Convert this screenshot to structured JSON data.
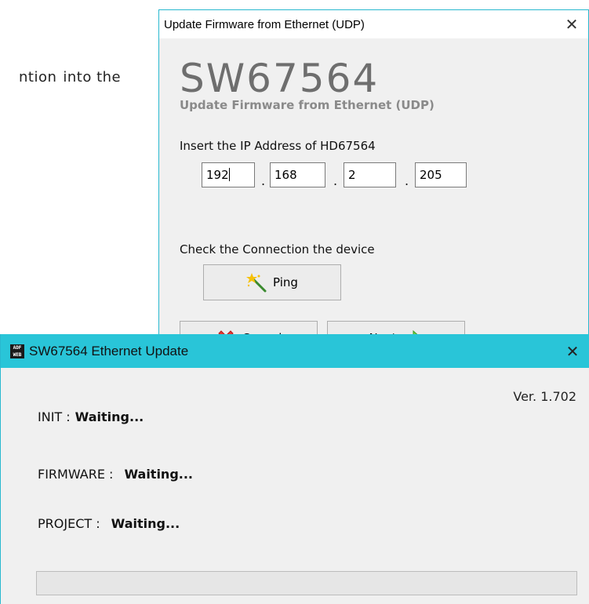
{
  "background_doc": {
    "text_fragment_left": "ntion",
    "text_fragment_right": "into the"
  },
  "udp_dialog": {
    "window_title": "Update Firmware from Ethernet (UDP)",
    "close_glyph": "✕",
    "app_code": "SW67564",
    "subtitle": "Update Firmware from Ethernet (UDP)",
    "ip_label": "Insert the IP Address of  HD67564",
    "ip": [
      "192",
      "168",
      "2",
      "205"
    ],
    "ip_separator": ".",
    "check_label": "Check the Connection the device",
    "ping_label": "Ping",
    "cancel_label": "Cancel",
    "next_label": "Next"
  },
  "update_window": {
    "title": "SW67564 Ethernet Update",
    "icon_text_top": "ADF",
    "icon_text_bottom": "WEB",
    "close_glyph": "✕",
    "version": "Ver. 1.702",
    "rows": [
      {
        "label": "INIT :",
        "value": "Waiting..."
      },
      {
        "label": "FIRMWARE :",
        "value": "Waiting..."
      },
      {
        "label": "PROJECT :",
        "value": "Waiting..."
      }
    ],
    "progress_fraction": 0
  },
  "colors": {
    "accent": "#29c5d8",
    "border": "#29b8cf",
    "cancel_red": "#e53935",
    "next_green": "#6fd44a"
  }
}
